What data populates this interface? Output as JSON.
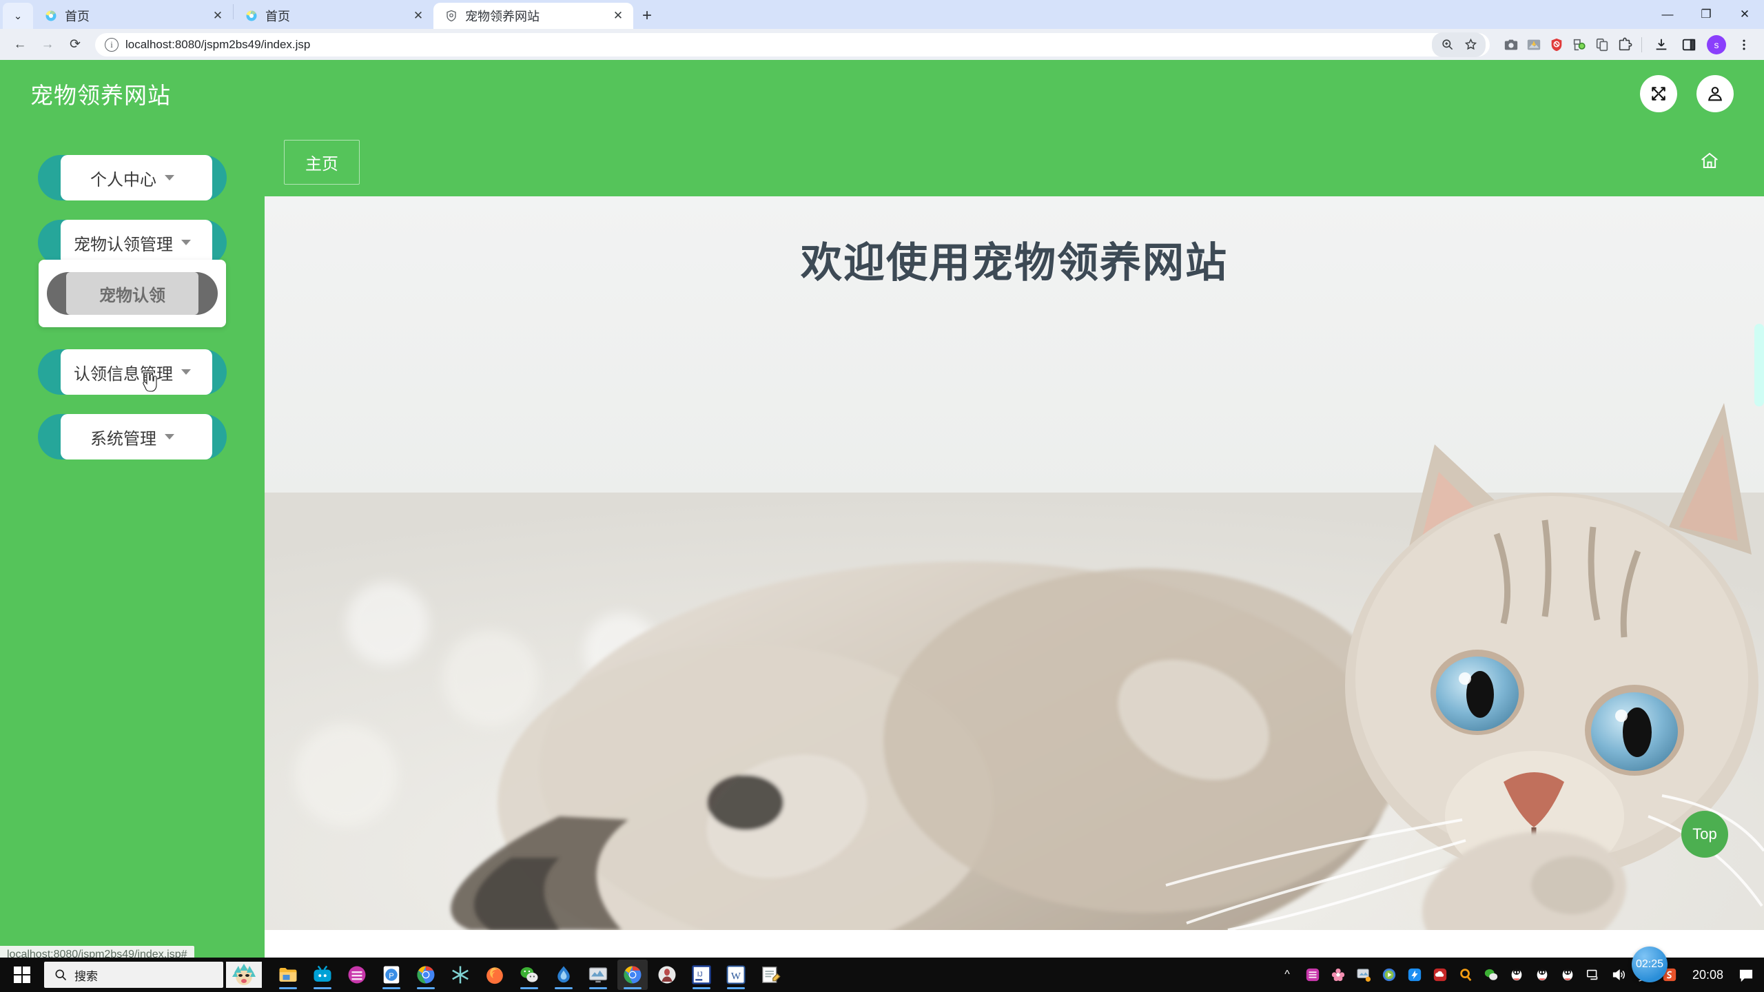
{
  "browser": {
    "tabs": [
      {
        "title": "首页",
        "active": false,
        "favicon": "chrome-globe-icon"
      },
      {
        "title": "首页",
        "active": false,
        "favicon": "chrome-globe-icon"
      },
      {
        "title": "宠物领养网站",
        "active": true,
        "favicon": "shield-site-icon"
      }
    ],
    "new_tab_label": "+",
    "tab_close_label": "✕",
    "tab_list_label": "⌄",
    "window_controls": {
      "minimize": "—",
      "maximize": "❐",
      "close": "✕"
    },
    "nav": {
      "back": "←",
      "forward": "→",
      "reload": "⟳"
    },
    "address": {
      "value": "localhost:8080/jspm2bs49/index.jsp",
      "info_icon": "site-info-icon"
    },
    "omnibox_actions": {
      "zoom": "🔍",
      "bookmark": "☆"
    },
    "extensions": [
      "camera-icon",
      "image-download-icon",
      "adblock-shield-icon",
      "capture-icon",
      "copy-icon",
      "extensions-puzzle-icon"
    ],
    "downloads_icon": "download-icon",
    "sidepanel_icon": "side-panel-icon",
    "profile_initial": "s",
    "menu_icon": "three-dot-menu-icon"
  },
  "app": {
    "title": "宠物领养网站",
    "header_actions": [
      {
        "name": "fullscreen-button",
        "icon": "fullscreen-arrows-icon"
      },
      {
        "name": "user-button",
        "icon": "user-avatar-icon"
      }
    ],
    "brand_color": "#55c45a",
    "accent_color": "#26a69a"
  },
  "sidebar": {
    "groups": [
      {
        "label": "个人中心",
        "expanded": false,
        "children": []
      },
      {
        "label": "宠物认领管理",
        "expanded": true,
        "children": [
          {
            "label": "宠物认领"
          }
        ]
      },
      {
        "label": "认领信息管理",
        "expanded": false,
        "children": []
      },
      {
        "label": "系统管理",
        "expanded": false,
        "children": []
      }
    ]
  },
  "content": {
    "tabs": [
      {
        "label": "主页",
        "active": true
      }
    ],
    "home_icon": "home-icon",
    "welcome_heading": "欢迎使用宠物领养网站",
    "hero_image_alt": "tabby-kitten-lying-on-white-blanket",
    "top_button_label": "Top"
  },
  "status_bar": {
    "text": "localhost:8080/jspm2bs49/index.jsp#"
  },
  "taskbar": {
    "search_placeholder": "搜索",
    "start_icon": "windows-start-icon",
    "apps": [
      {
        "name": "file-explorer",
        "running": true
      },
      {
        "name": "bilibili",
        "running": true
      },
      {
        "name": "app-colorful",
        "running": false
      },
      {
        "name": "wps-presentation",
        "running": true
      },
      {
        "name": "chrome",
        "running": true
      },
      {
        "name": "app-snowflake",
        "running": false
      },
      {
        "name": "firefox",
        "running": false
      },
      {
        "name": "wechat",
        "running": true
      },
      {
        "name": "app-blue-drop",
        "running": true
      },
      {
        "name": "app-monitor",
        "running": true
      },
      {
        "name": "chrome-active",
        "running": true,
        "active": true
      },
      {
        "name": "app-person",
        "running": false
      },
      {
        "name": "intellij-idea",
        "running": true
      },
      {
        "name": "word",
        "running": true
      },
      {
        "name": "notepad",
        "running": false
      }
    ],
    "tray": [
      "chevron-up-icon",
      "app-rainbow-icon",
      "app-flower-icon",
      "screenshot-icon",
      "media-player-icon",
      "dingtalk-icon",
      "cloud-icon",
      "search-orange-icon",
      "wechat-icon",
      "qq-icon",
      "qq-icon",
      "qq-icon",
      "network-icon",
      "volume-icon",
      "ime-chinese-icon",
      "sogou-icon"
    ],
    "clock": "20:08",
    "notifications_icon": "notification-icon",
    "floating_clock": "02:25"
  }
}
